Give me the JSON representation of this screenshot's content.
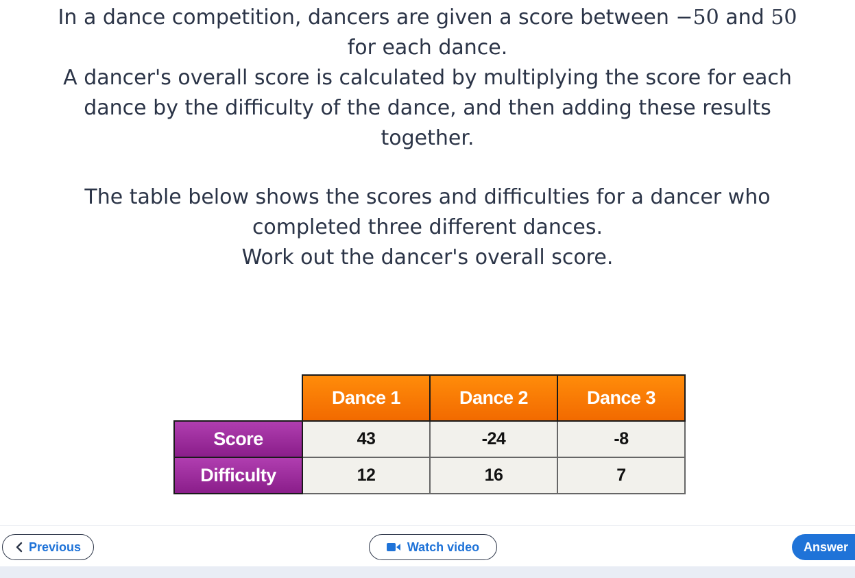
{
  "question": {
    "line1_a": "In a dance competition, dancers are given a score between ",
    "min_score": "−50",
    "line1_b": " and ",
    "max_score": "50",
    "line2": "for each dance.",
    "line3": "A dancer's overall score is calculated by multiplying the score for each",
    "line4": "dance by the difficulty of the dance, and then adding these results",
    "line5": "together.",
    "line6": "The table below shows the scores and difficulties for a dancer who",
    "line7": "completed three different dances.",
    "line8": "Work out the dancer's overall score."
  },
  "table": {
    "columns": [
      "Dance 1",
      "Dance 2",
      "Dance 3"
    ],
    "rows": [
      {
        "label": "Score",
        "values": [
          "43",
          "-24",
          "-8"
        ]
      },
      {
        "label": "Difficulty",
        "values": [
          "12",
          "16",
          "7"
        ]
      }
    ]
  },
  "footer": {
    "previous_label": "Previous",
    "video_label": "Watch video",
    "answer_label": "Answer"
  },
  "colors": {
    "header_orange": "#f26a00",
    "row_purple": "#8a1e8a",
    "accent_blue": "#1f73d8"
  },
  "icons": {
    "previous": "chevron-left-icon",
    "video": "video-camera-icon"
  }
}
